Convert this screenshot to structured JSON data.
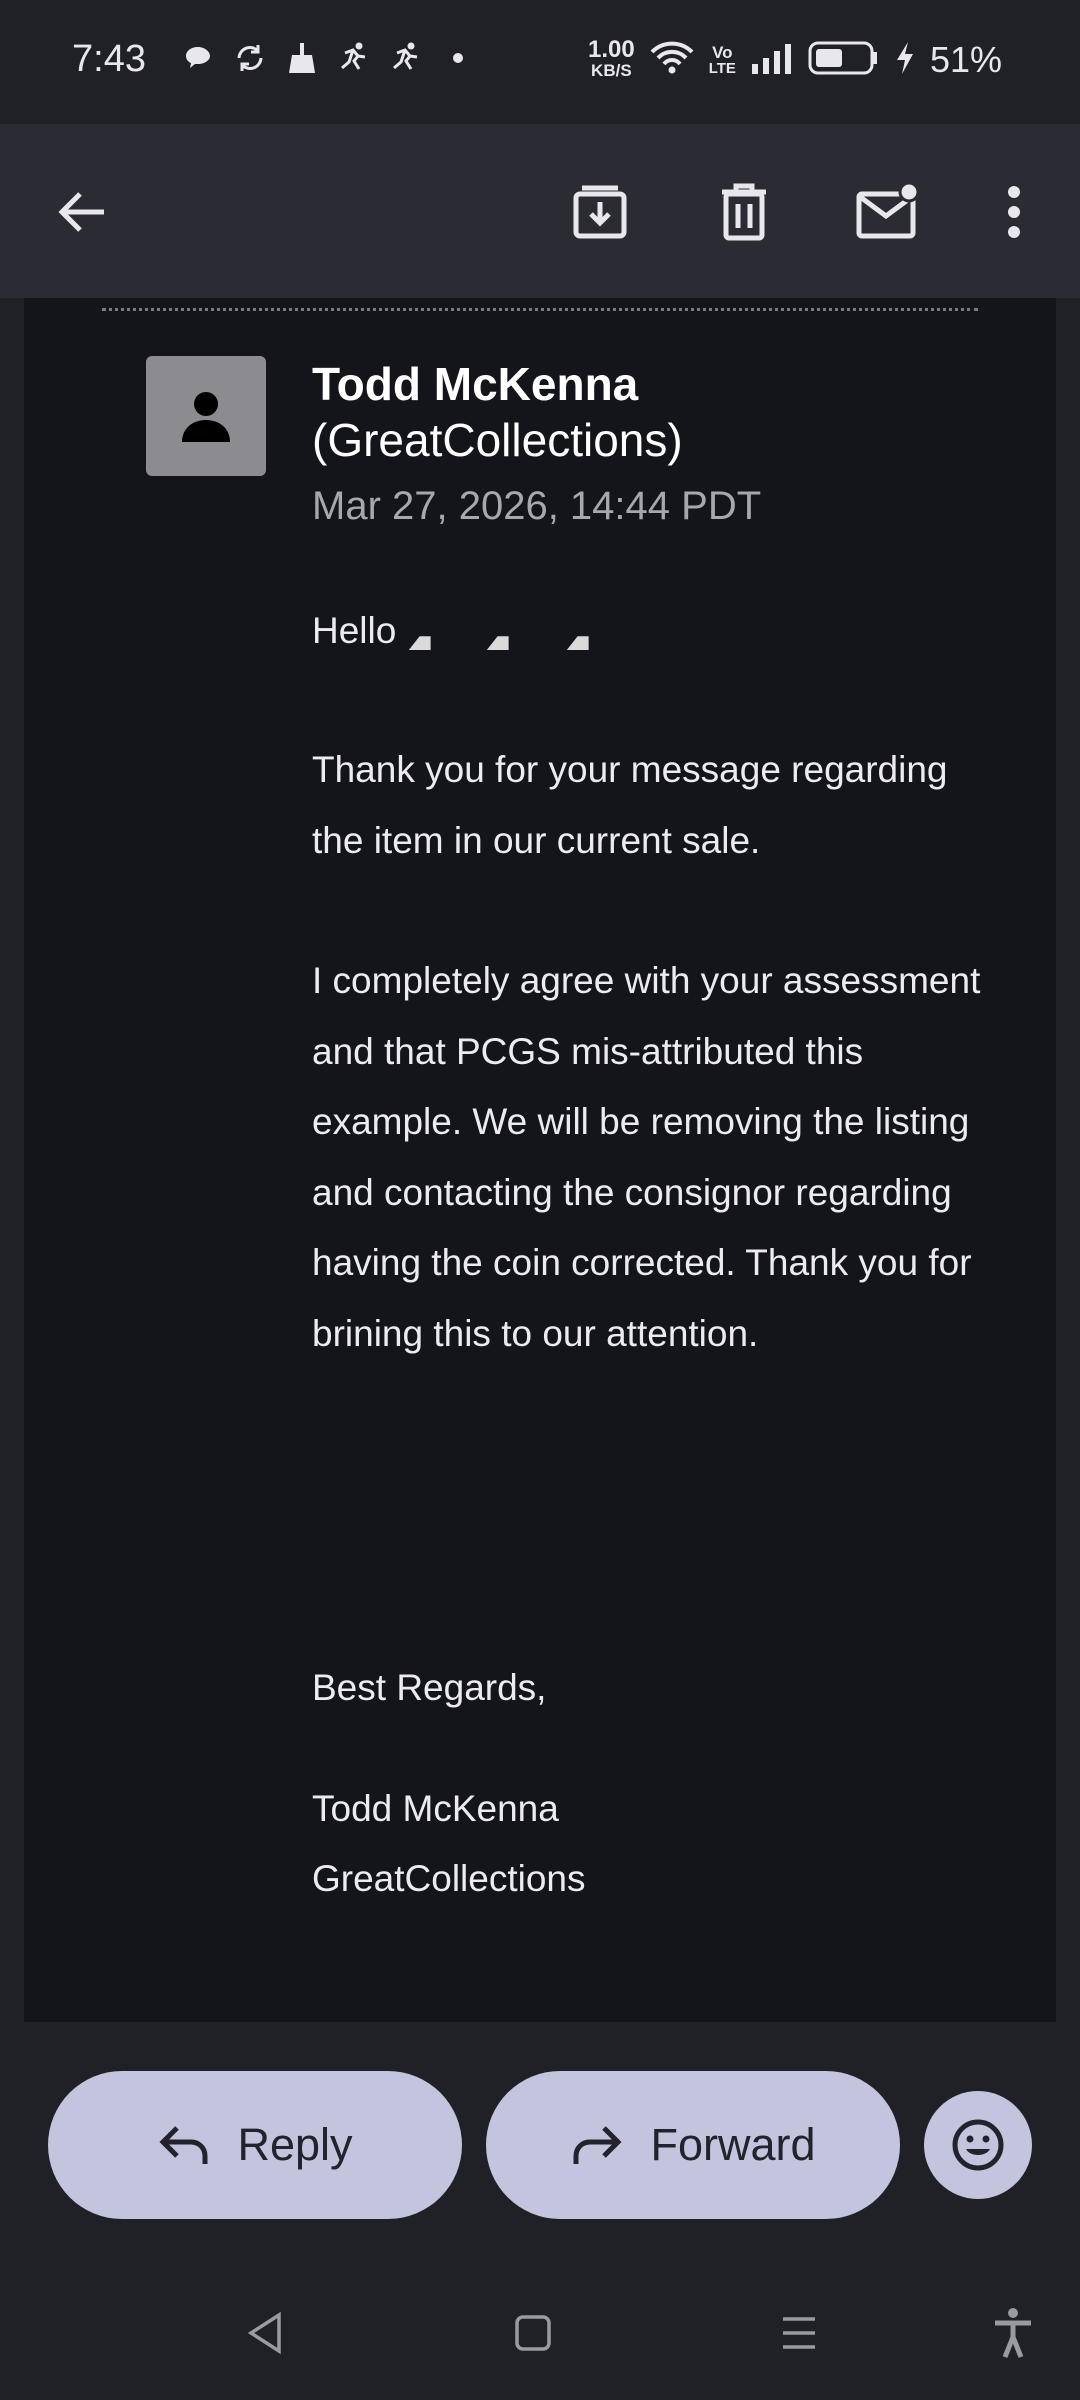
{
  "status_bar": {
    "time": "7:43",
    "net_speed_value": "1.00",
    "net_speed_unit": "KB/S",
    "volte_label_top": "Vo",
    "volte_label_bottom": "LTE",
    "battery_percent": "51%",
    "notification_icons": [
      "chat-bubble-icon",
      "sync-icon",
      "broom-icon",
      "runner-icon",
      "runner-icon",
      "dot-icon"
    ]
  },
  "toolbar": {
    "icons": [
      "back-arrow-icon",
      "archive-icon",
      "delete-icon",
      "mark-unread-icon",
      "more-vert-icon"
    ]
  },
  "message": {
    "sender_name": "Todd McKenna",
    "sender_org": "(GreatCollections)",
    "date": "Mar 27, 2026, 14:44 PDT",
    "greeting": "Hello",
    "paragraphs": [
      "Thank you for your message regarding the item in our current sale.",
      "I completely agree with your assessment and that PCGS mis-attributed this example. We will be removing the listing and contacting the consignor regarding having the coin corrected. Thank you for brining this to our attention.",
      "Best Regards,"
    ],
    "signature_name": "Todd McKenna",
    "signature_org": "GreatCollections"
  },
  "actions": {
    "reply_label": "Reply",
    "forward_label": "Forward"
  },
  "colors": {
    "background": "#202127",
    "card": "#14151b",
    "button": "#c3c4dd"
  }
}
